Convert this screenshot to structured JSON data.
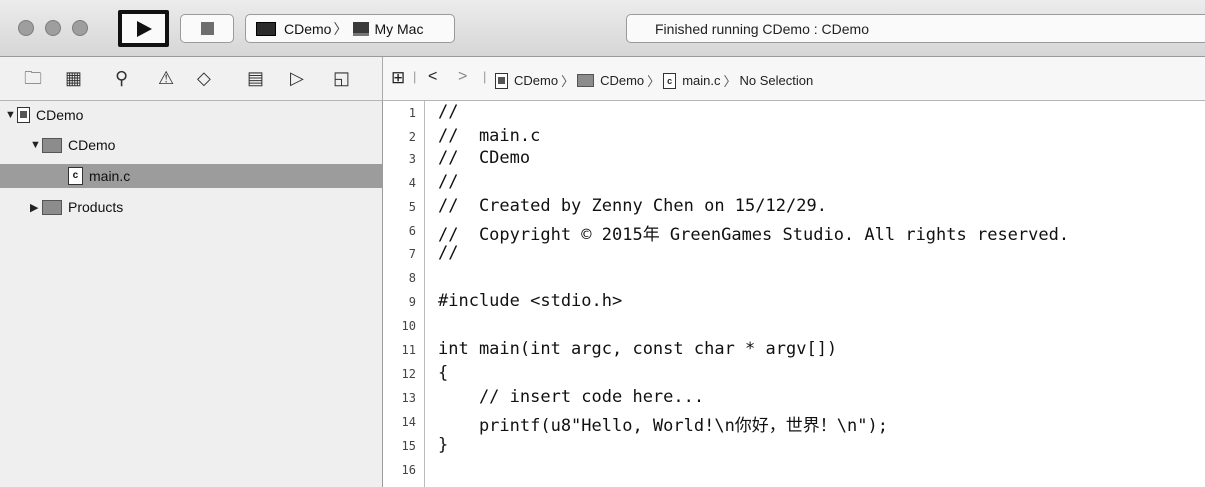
{
  "toolbar": {
    "scheme_target": "CDemo",
    "separator": "〉",
    "scheme_device": "My Mac",
    "status": "Finished running CDemo : CDemo"
  },
  "navigator_icons": [
    "folder-icon",
    "hierarchy-icon",
    "search-icon",
    "warning-icon",
    "diamond-icon",
    "list-icon",
    "tag-icon",
    "chat-icon"
  ],
  "jumpbar": {
    "back": "<",
    "forward": ">",
    "project": "CDemo",
    "group": "CDemo",
    "file": "main.c",
    "selection": "No Selection"
  },
  "navigator": {
    "items": [
      {
        "label": "CDemo"
      },
      {
        "label": "CDemo"
      },
      {
        "label": "main.c"
      },
      {
        "label": "Products"
      }
    ]
  },
  "editor": {
    "lines": [
      {
        "num": "1",
        "text": "//"
      },
      {
        "num": "2",
        "text": "//  main.c"
      },
      {
        "num": "3",
        "text": "//  CDemo"
      },
      {
        "num": "4",
        "text": "//"
      },
      {
        "num": "5",
        "text": "//  Created by Zenny Chen on 15/12/29."
      },
      {
        "num": "6",
        "text": "//  Copyright © 2015年 GreenGames Studio. All rights reserved."
      },
      {
        "num": "7",
        "text": "//"
      },
      {
        "num": "8",
        "text": ""
      },
      {
        "num": "9",
        "text": "#include <stdio.h>"
      },
      {
        "num": "10",
        "text": ""
      },
      {
        "num": "11",
        "text": "int main(int argc, const char * argv[])"
      },
      {
        "num": "12",
        "text": "{"
      },
      {
        "num": "13",
        "text": "    // insert code here..."
      },
      {
        "num": "14",
        "text": "    printf(u8\"Hello, World!\\n你好，世界！\\n\");"
      },
      {
        "num": "15",
        "text": "}"
      },
      {
        "num": "16",
        "text": ""
      }
    ]
  }
}
